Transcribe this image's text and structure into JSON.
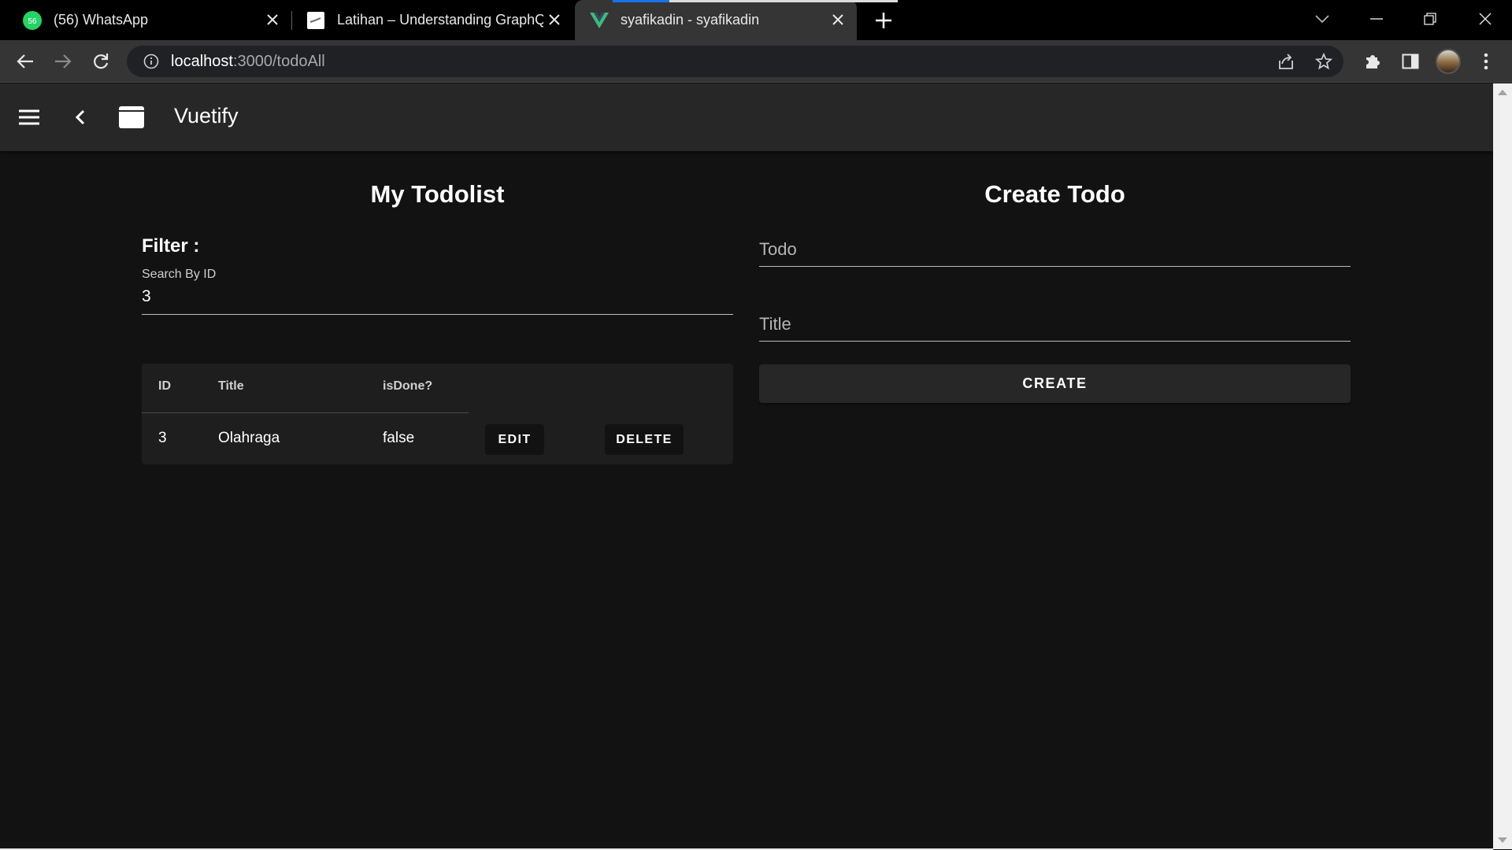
{
  "browser": {
    "tabs": [
      {
        "title": "(56) WhatsApp",
        "badge": "56"
      },
      {
        "title": "Latihan – Understanding GraphQL"
      },
      {
        "title": "syafikadin - syafikadin"
      }
    ],
    "active_tab": 2,
    "url_host": "localhost",
    "url_path": ":3000/todoAll",
    "loading_progress": 0.2
  },
  "app": {
    "title": "Vuetify"
  },
  "todolist": {
    "heading": "My Todolist",
    "filter_label": "Filter :",
    "search_label": "Search By ID",
    "search_value": "3",
    "columns": [
      "ID",
      "Title",
      "isDone?"
    ],
    "rows": [
      {
        "id": "3",
        "title": "Olahraga",
        "done": "false",
        "edit_label": "EDIT",
        "delete_label": "DELETE"
      }
    ]
  },
  "create": {
    "heading": "Create Todo",
    "todo_placeholder": "Todo",
    "title_placeholder": "Title",
    "button_label": "CREATE"
  },
  "colors": {
    "background": "#121212",
    "app_bar": "#272727",
    "whatsapp_green": "#25d366",
    "vue_green": "#41b883",
    "loading_blue": "#1a73e8"
  }
}
